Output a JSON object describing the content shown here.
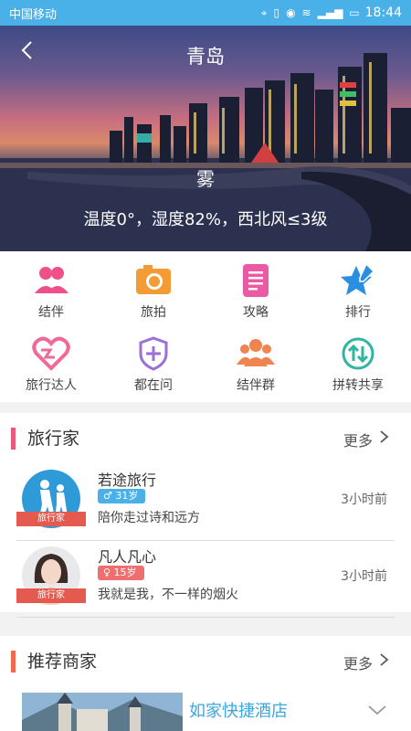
{
  "status_bar": {
    "carrier": "中国移动",
    "time": "18:44"
  },
  "header": {
    "city": "青岛",
    "weather": "雾",
    "detail": "温度0°，湿度82%，西北风≤3级"
  },
  "features": [
    {
      "label": "结伴",
      "icon": "companions-icon",
      "color": "#f0508a"
    },
    {
      "label": "旅拍",
      "icon": "camera-icon",
      "color": "#f39b35"
    },
    {
      "label": "攻略",
      "icon": "guide-document-icon",
      "color": "#ec5aa3"
    },
    {
      "label": "排行",
      "icon": "ranking-star-icon",
      "color": "#2a8fe0"
    },
    {
      "label": "旅行达人",
      "icon": "heart-icon",
      "color": "#f06a97"
    },
    {
      "label": "都在问",
      "icon": "shield-plus-icon",
      "color": "#9b6fd6"
    },
    {
      "label": "结伴群",
      "icon": "group-icon",
      "color": "#f0834f"
    },
    {
      "label": "拼转共享",
      "icon": "swap-arrows-icon",
      "color": "#2fb6a2"
    }
  ],
  "travelers": {
    "title": "旅行家",
    "more": "更多",
    "accent": "#e8597a",
    "items": [
      {
        "name": "若途旅行",
        "badge": "♂ 31岁",
        "badge_color": "#4ab0e8",
        "desc": "陪你走过诗和远方",
        "time": "3小时前",
        "ribbon": "旅行家"
      },
      {
        "name": "凡人凡心",
        "badge": "♀ 15岁",
        "badge_color": "#ef6e6e",
        "desc": "我就是我，不一样的烟火",
        "time": "3小时前",
        "ribbon": "旅行家"
      }
    ]
  },
  "merchants": {
    "title": "推荐商家",
    "more": "更多",
    "accent": "#f06a4f",
    "first_name": "如家快捷酒店"
  }
}
